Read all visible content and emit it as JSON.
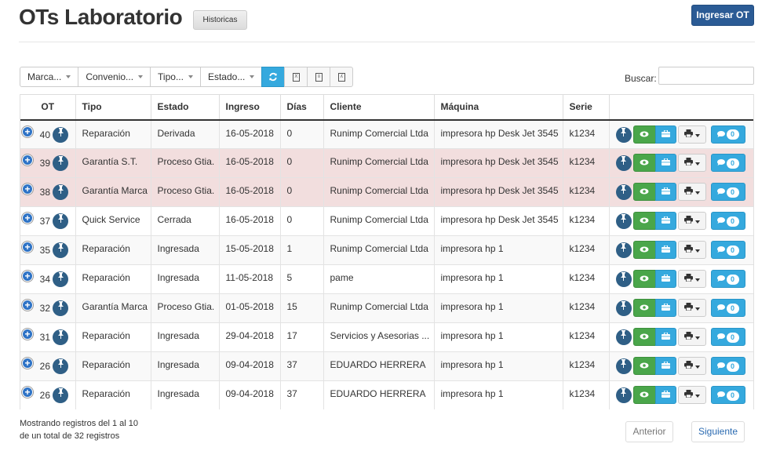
{
  "header": {
    "title": "OTs Laboratorio",
    "historicas_label": "Historicas",
    "ingresar_label": "Ingresar OT"
  },
  "toolbar": {
    "filters": [
      "Marca...",
      "Convenio...",
      "Tipo...",
      "Estado..."
    ],
    "icons": [
      "refresh-icon",
      "excel-icon",
      "document-icon",
      "pdf-icon"
    ],
    "search_label": "Buscar:",
    "search_value": ""
  },
  "table": {
    "headers": [
      "OT",
      "Tipo",
      "Estado",
      "Ingreso",
      "Días",
      "Cliente",
      "Máquina",
      "Serie",
      ""
    ],
    "rows": [
      {
        "ot": "40",
        "tipo": "Reparación",
        "estado": "Derivada",
        "ingreso": "16-05-2018",
        "dias": "0",
        "cliente": "Runimp Comercial Ltda",
        "maquina": "impresora hp Desk Jet 3545",
        "serie": "k1234",
        "comments": "0",
        "highlight": "odd"
      },
      {
        "ot": "39",
        "tipo": "Garantía S.T.",
        "estado": "Proceso Gtia.",
        "ingreso": "16-05-2018",
        "dias": "0",
        "cliente": "Runimp Comercial Ltda",
        "maquina": "impresora hp Desk Jet 3545",
        "serie": "k1234",
        "comments": "0",
        "highlight": "pink"
      },
      {
        "ot": "38",
        "tipo": "Garantía Marca",
        "estado": "Proceso Gtia.",
        "ingreso": "16-05-2018",
        "dias": "0",
        "cliente": "Runimp Comercial Ltda",
        "maquina": "impresora hp Desk Jet 3545",
        "serie": "k1234",
        "comments": "0",
        "highlight": "pink"
      },
      {
        "ot": "37",
        "tipo": "Quick Service",
        "estado": "Cerrada",
        "ingreso": "16-05-2018",
        "dias": "0",
        "cliente": "Runimp Comercial Ltda",
        "maquina": "impresora hp Desk Jet 3545",
        "serie": "k1234",
        "comments": "0",
        "highlight": "none"
      },
      {
        "ot": "35",
        "tipo": "Reparación",
        "estado": "Ingresada",
        "ingreso": "15-05-2018",
        "dias": "1",
        "cliente": "Runimp Comercial Ltda",
        "maquina": "impresora hp 1",
        "serie": "k1234",
        "comments": "0",
        "highlight": "odd"
      },
      {
        "ot": "34",
        "tipo": "Reparación",
        "estado": "Ingresada",
        "ingreso": "11-05-2018",
        "dias": "5",
        "cliente": "pame",
        "maquina": "impresora hp 1",
        "serie": "k1234",
        "comments": "0",
        "highlight": "none"
      },
      {
        "ot": "32",
        "tipo": "Garantía Marca",
        "estado": "Proceso Gtia.",
        "ingreso": "01-05-2018",
        "dias": "15",
        "cliente": "Runimp Comercial Ltda",
        "maquina": "impresora hp 1",
        "serie": "k1234",
        "comments": "0",
        "highlight": "odd"
      },
      {
        "ot": "31",
        "tipo": "Reparación",
        "estado": "Ingresada",
        "ingreso": "29-04-2018",
        "dias": "17",
        "cliente": "Servicios y Asesorias ...",
        "maquina": "impresora hp 1",
        "serie": "k1234",
        "comments": "0",
        "highlight": "none"
      },
      {
        "ot": "26",
        "tipo": "Reparación",
        "estado": "Ingresada",
        "ingreso": "09-04-2018",
        "dias": "37",
        "cliente": "EDUARDO HERRERA",
        "maquina": "impresora hp 1",
        "serie": "k1234",
        "comments": "0",
        "highlight": "odd"
      },
      {
        "ot": "26",
        "tipo": "Reparación",
        "estado": "Ingresada",
        "ingreso": "09-04-2018",
        "dias": "37",
        "cliente": "EDUARDO HERRERA",
        "maquina": "impresora hp 1",
        "serie": "k1234",
        "comments": "0",
        "highlight": "none"
      }
    ]
  },
  "footer": {
    "info_line1": "Mostrando registros del 1 al 10",
    "info_line2": "de un total de 32 registros",
    "prev_label": "Anterior",
    "next_label": "Siguiente"
  },
  "colors": {
    "primary": "#2b5b95",
    "info": "#35a9de",
    "success": "#4aa64a",
    "danger_row": "#f2dede"
  }
}
